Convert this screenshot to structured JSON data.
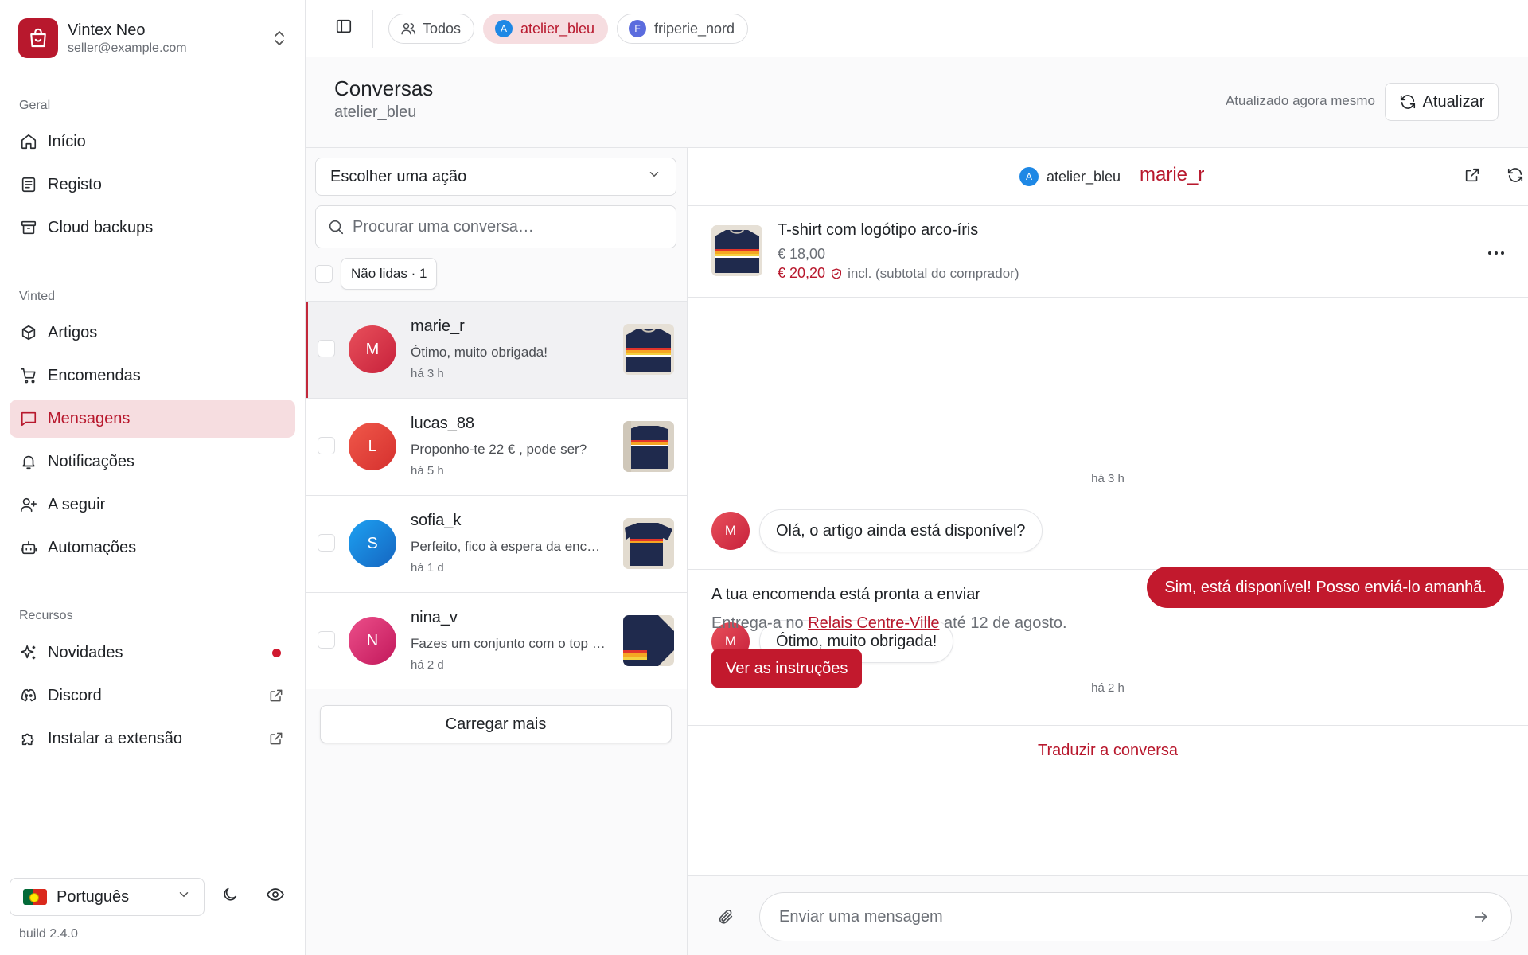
{
  "brand": {
    "name": "Vintex Neo",
    "email": "seller@example.com"
  },
  "nav": {
    "section_geral": "Geral",
    "section_vinted": "Vinted",
    "section_recursos": "Recursos",
    "inicio": "Início",
    "registo": "Registo",
    "backups": "Cloud backups",
    "artigos": "Artigos",
    "encomendas": "Encomendas",
    "mensagens": "Mensagens",
    "notificacoes": "Notificações",
    "seguir": "A seguir",
    "automacoes": "Automações",
    "novidades": "Novidades",
    "discord": "Discord",
    "extensao": "Instalar a extensão"
  },
  "footer": {
    "language": "Português",
    "build": "build 2.4.0"
  },
  "topbar": {
    "tabs": [
      {
        "label": "Todos",
        "avatar": ""
      },
      {
        "label": "atelier_bleu",
        "avatar": "A"
      },
      {
        "label": "friperie_nord",
        "avatar": "F"
      }
    ]
  },
  "header": {
    "title": "Conversas",
    "subtitle": "atelier_bleu",
    "updated": "Atualizado agora mesmo",
    "refresh_label": "Atualizar"
  },
  "list": {
    "action_placeholder": "Escolher uma ação",
    "search_placeholder": "Procurar uma conversa…",
    "unread_filter": "Não lidas · 1",
    "load_more": "Carregar mais",
    "conversations": [
      {
        "initial": "M",
        "name": "marie_r",
        "preview": "Ótimo, muito obrigada!",
        "time": "há 3 h"
      },
      {
        "initial": "L",
        "name": "lucas_88",
        "preview": "Proponho-te 22 € , pode ser?",
        "time": "há 5 h"
      },
      {
        "initial": "S",
        "name": "sofia_k",
        "preview": "Perfeito, fico à espera da encomenda!",
        "time": "há 1 d"
      },
      {
        "initial": "N",
        "name": "nina_v",
        "preview": "Fazes um conjunto com o top azul?",
        "time": "há 2 d"
      }
    ]
  },
  "chat": {
    "account_initial": "A",
    "account": "atelier_bleu",
    "partner": "marie_r",
    "item": {
      "title": "T-shirt com logótipo arco-íris",
      "price": "€ 18,00",
      "total": "€ 20,20",
      "total_note": "incl. (subtotal do comprador)"
    },
    "messages": {
      "ts1": "há 3 h",
      "in1": "Olá, o artigo ainda está disponível?",
      "out1": "Sim, está disponível! Posso enviá-lo amanhã.",
      "in2": "Ótimo, muito obrigada!",
      "ts2": "há 2 h",
      "avatar": "M"
    },
    "notice": {
      "title": "A tua encomenda está pronta a enviar",
      "text_before": "Entrega-a no ",
      "link": "Relais Centre-Ville",
      "text_after": " até 12 de agosto.",
      "button": "Ver as instruções"
    },
    "translate": "Traduzir a conversa",
    "composer_placeholder": "Enviar uma mensagem"
  },
  "colors": {
    "brand": "#b8182d",
    "active_bg": "#f6dde0",
    "sent_bubble": "#c2192d"
  }
}
